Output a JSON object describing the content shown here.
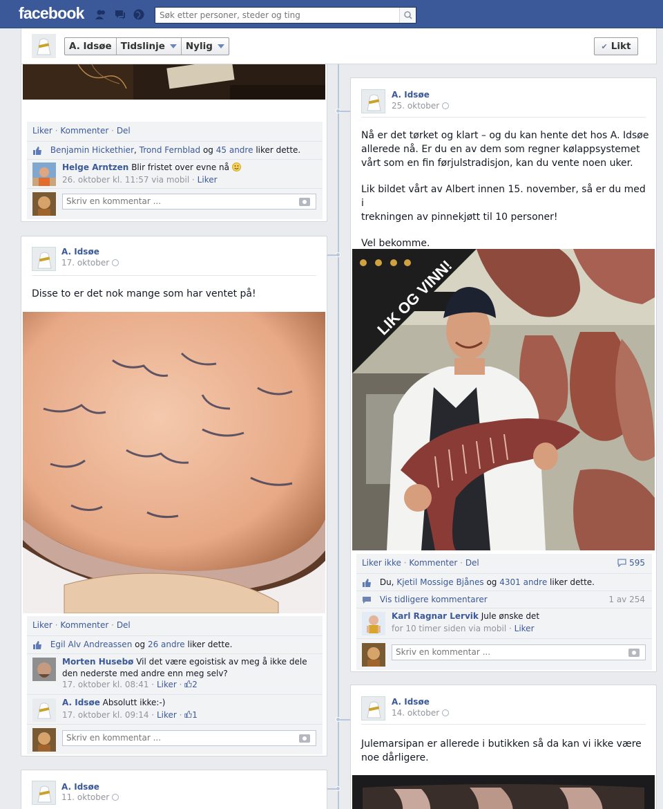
{
  "topbar": {
    "logo": "facebook",
    "search_placeholder": "Søk etter personer, steder og ting"
  },
  "navbar": {
    "page_name": "A. Idsøe",
    "timeline": "Tidslinje",
    "recent": "Nylig",
    "liked": "Likt"
  },
  "colors": {
    "brand": "#3b5998",
    "link": "#3b5998",
    "meta": "#90949c"
  },
  "post_a": {
    "actions": [
      "Liker",
      "Kommenter",
      "Del"
    ],
    "likes": {
      "user1": "Benjamin Hickethier",
      "user2": "Trond Fernblad",
      "joiner": "og",
      "others": "45 andre",
      "suffix": "liker dette."
    },
    "comment": {
      "author": "Helge Arntzen",
      "text": "Blir fristet over evne nå",
      "emoji": "smiley-icon",
      "meta": "26. oktober kl. 11:57 via mobil",
      "like": "Liker"
    },
    "input": "Skriv en kommentar ..."
  },
  "post_b": {
    "author": "A. Idsøe",
    "date": "17. oktober",
    "text": "Disse to er det nok mange som har ventet på!",
    "photo": "blue-cheese-photo",
    "actions": [
      "Liker",
      "Kommenter",
      "Del"
    ],
    "likes": {
      "user1": "Egil Alv Andreassen",
      "joiner": "og",
      "others": "26 andre",
      "suffix": "liker dette."
    },
    "comments": [
      {
        "author": "Morten Husebø",
        "text_line1": "Vil det være egoistisk av meg å ikke dele",
        "text_line2": "den nederste med andre enn meg selv?",
        "meta": "17. oktober kl. 08:41",
        "like": "Liker",
        "count": "2"
      },
      {
        "author": "A. Idsøe",
        "text": "Absolutt ikke:-)",
        "meta": "17. oktober kl. 09:14",
        "like": "Liker",
        "count": "1"
      }
    ],
    "input": "Skriv en kommentar ..."
  },
  "post_c": {
    "author": "A. Idsøe",
    "date": "11. oktober"
  },
  "post_d": {
    "author": "A. Idsøe",
    "date": "25. oktober",
    "para1": [
      "Nå er det tørket og klart – og du kan hente det hos A. Idsøe",
      "allerede nå. Er du en av dem som regner kølappsystemet",
      "vårt som en fin førjulstradisjon, kan du vente noen uker."
    ],
    "para2": [
      "Lik bildet vårt av Albert innen 15. november, så er du med i",
      "trekningen av pinnekjøtt til 10 personer!"
    ],
    "para3": "Vel bekomme.",
    "banner": "LIK OG VINN!",
    "photo": "butcher-photo",
    "actions": [
      "Liker ikke",
      "Kommenter",
      "Del"
    ],
    "comment_count": "595",
    "likes": {
      "prefix": "Du,",
      "user1": "Kjetil Mossige Bjånes",
      "joiner": "og",
      "others": "4301 andre",
      "suffix": "liker dette."
    },
    "view_previous": "Vis tidligere kommentarer",
    "pager": "1 av 254",
    "comment": {
      "author": "Karl Ragnar Lervik",
      "text": "Jule ønske det",
      "meta": "for 10 timer siden via mobil",
      "like": "Liker"
    },
    "input": "Skriv en kommentar ..."
  },
  "post_e": {
    "author": "A. Idsøe",
    "date": "14. oktober",
    "text_line1": "Julemarsipan er allerede i butikken så da kan vi ikke være",
    "text_line2": "noe dårligere."
  }
}
